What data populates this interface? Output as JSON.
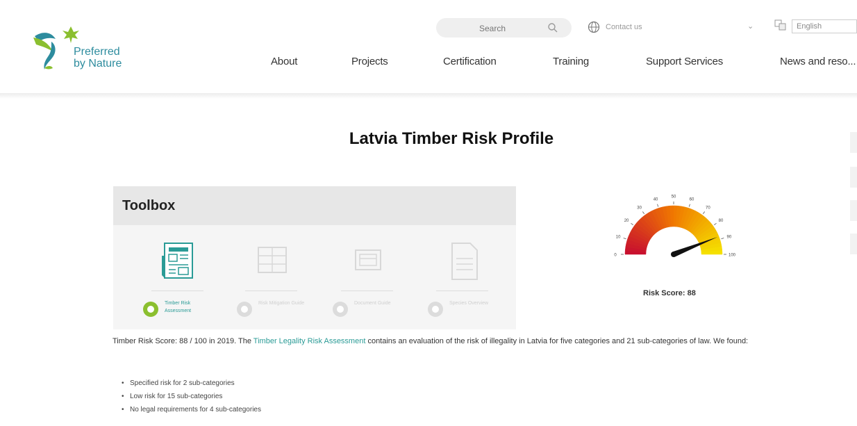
{
  "header": {
    "logo_line1": "Preferred",
    "logo_line2": "by Nature",
    "search_placeholder": "Search",
    "contact_label": "Contact us",
    "language_value": "English",
    "nav": [
      "About",
      "Projects",
      "Certification",
      "Training",
      "Support Services",
      "News and reso..."
    ]
  },
  "main": {
    "title": "Latvia Timber Risk Profile",
    "toolbox": {
      "title": "Toolbox",
      "tools": [
        {
          "label": "Timber Risk Assessment",
          "state": "active"
        },
        {
          "label": "Risk Mitigation Guide",
          "state": "inactive"
        },
        {
          "label": "Document Guide",
          "state": "inactive"
        },
        {
          "label": "Species Overview",
          "state": "inactive"
        }
      ]
    },
    "gauge": {
      "min": 0,
      "max": 100,
      "value": 88,
      "ticks": [
        "0",
        "10",
        "20",
        "30",
        "40",
        "50",
        "60",
        "70",
        "80",
        "90",
        "100"
      ],
      "label": "Risk Score: 88"
    },
    "intro": {
      "before": "Timber Risk Score: 88 / 100 in 2019. The ",
      "link": "Timber Legality Risk Assessment",
      "after": " contains an evaluation of the risk of illegality in Latvia for five categories and 21 sub-categories of law. We found:"
    },
    "bullets": [
      "Specified risk for 2 sub-categories",
      "Low risk for 15 sub-categories",
      "No legal requirements for 4 sub-categories"
    ]
  },
  "colors": {
    "teal": "#2a9b96",
    "green": "#8bbf2f",
    "gauge_red": "#c8102e",
    "gauge_orange": "#f08c00",
    "gauge_yellow": "#f5e000"
  }
}
